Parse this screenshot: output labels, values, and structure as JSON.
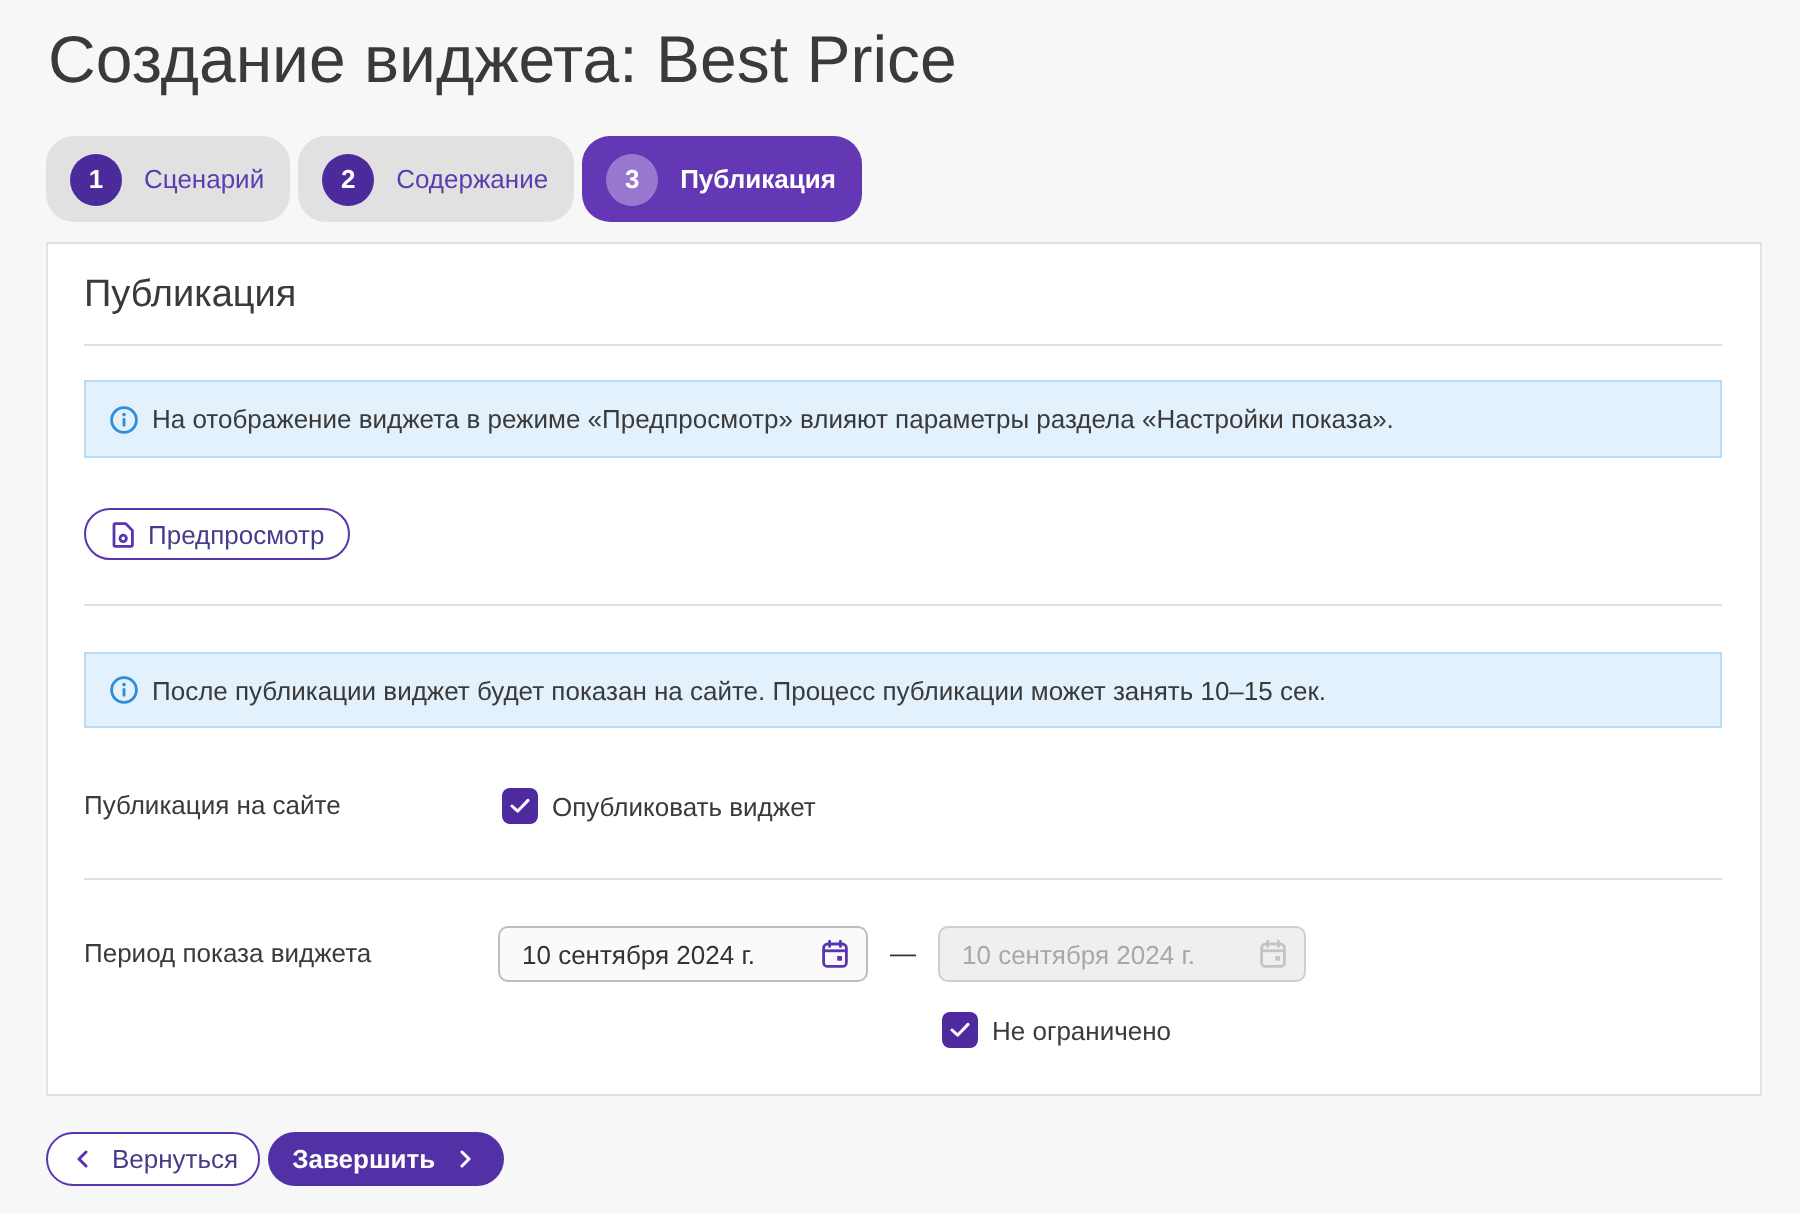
{
  "page": {
    "title": "Создание виджета: Best Price"
  },
  "steps": [
    {
      "number": "1",
      "label": "Сценарий",
      "selected": false
    },
    {
      "number": "2",
      "label": "Содержание",
      "selected": false
    },
    {
      "number": "3",
      "label": "Публикация",
      "selected": true
    }
  ],
  "section": {
    "title": "Публикация",
    "preview_notice": "На отображение виджета в режиме «Предпросмотр» влияют параметры раздела «Настройки показа».",
    "preview_button": "Предпросмотр",
    "publish_notice": "После публикации виджет будет показан на сайте. Процесс публикации может занять 10–15 сек.",
    "publish_row": {
      "label": "Публикация на сайте",
      "checkbox": {
        "label": "Опубликовать виджет",
        "checked": true
      }
    },
    "period_row": {
      "label": "Период показа виджета",
      "start": {
        "value": "10 сентября 2024 г.",
        "disabled": false
      },
      "separator": "—",
      "end": {
        "value": "10 сентября 2024 г.",
        "disabled": true
      },
      "unlimited": {
        "label": "Не ограничено",
        "checked": true
      }
    }
  },
  "footer": {
    "back_button": "Вернуться",
    "finish_button": "Завершить"
  }
}
